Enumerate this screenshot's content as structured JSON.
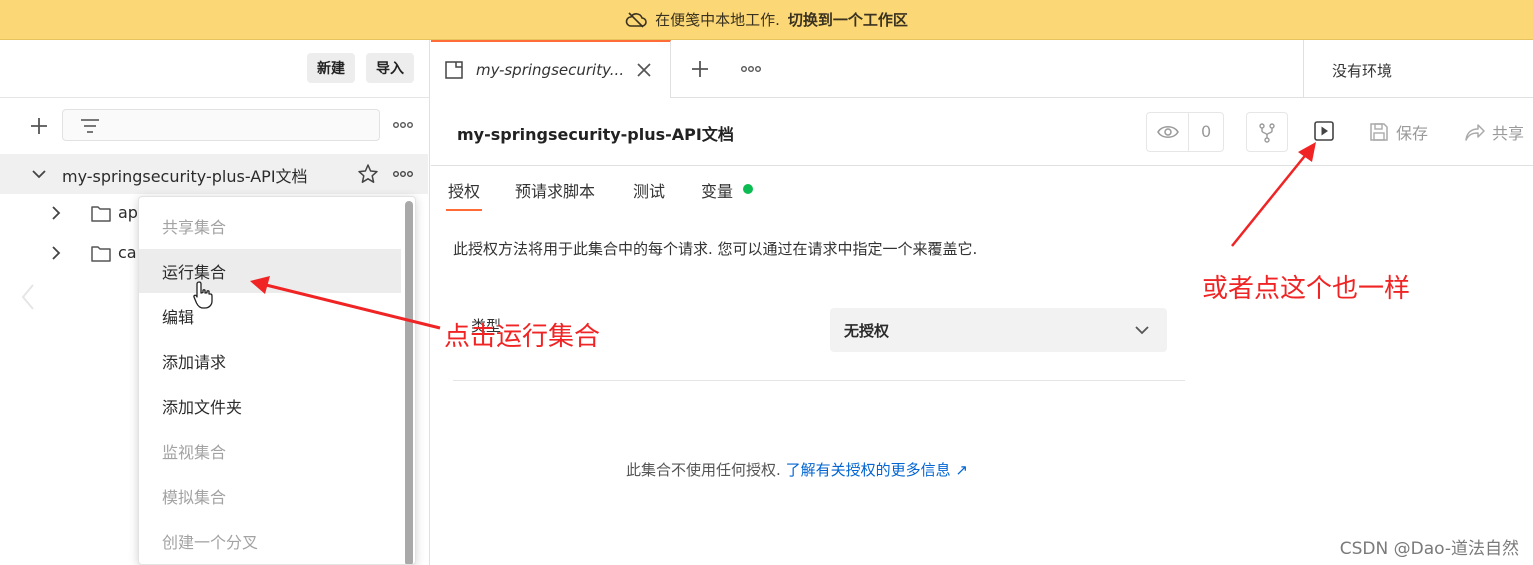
{
  "banner": {
    "text": "在便笺中本地工作.",
    "link": "切换到一个工作区",
    "icon": "cloud-offline-icon"
  },
  "sidebar": {
    "new_button": "新建",
    "import_button": "导入",
    "collection_name": "my-springsecurity-plus-API文档",
    "folders": [
      {
        "label": "ap"
      },
      {
        "label": "ca"
      }
    ]
  },
  "context_menu": {
    "items": [
      {
        "label": "共享集合",
        "enabled": false
      },
      {
        "label": "运行集合",
        "enabled": true
      },
      {
        "label": "编辑",
        "enabled": true
      },
      {
        "label": "添加请求",
        "enabled": true
      },
      {
        "label": "添加文件夹",
        "enabled": true
      },
      {
        "label": "监视集合",
        "enabled": false
      },
      {
        "label": "模拟集合",
        "enabled": false
      },
      {
        "label": "创建一个分叉",
        "enabled": false
      }
    ]
  },
  "tabs": {
    "active_title": "my-springsecurity...",
    "environment": "没有环境"
  },
  "header": {
    "title": "my-springsecurity-plus-API文档",
    "watch_count": "0",
    "save_label": "保存",
    "share_label": "共享"
  },
  "subtabs": [
    {
      "label": "授权"
    },
    {
      "label": "预请求脚本"
    },
    {
      "label": "测试"
    },
    {
      "label": "变量"
    }
  ],
  "auth": {
    "description": "此授权方法将用于此集合中的每个请求. 您可以通过在请求中指定一个来覆盖它.",
    "type_label": "类型",
    "type_value": "无授权",
    "note": "此集合不使用任何授权.",
    "learn_more": "了解有关授权的更多信息 ↗"
  },
  "annotations": {
    "left": "点击运行集合",
    "right": "或者点这个也一样"
  },
  "watermark": "CSDN @Dao-道法自然",
  "colors": {
    "banner": "#fbd775",
    "accent": "#ff6c37",
    "annotation": "#f02424",
    "link": "#0265d2",
    "variable_dot": "#0cbb52"
  }
}
